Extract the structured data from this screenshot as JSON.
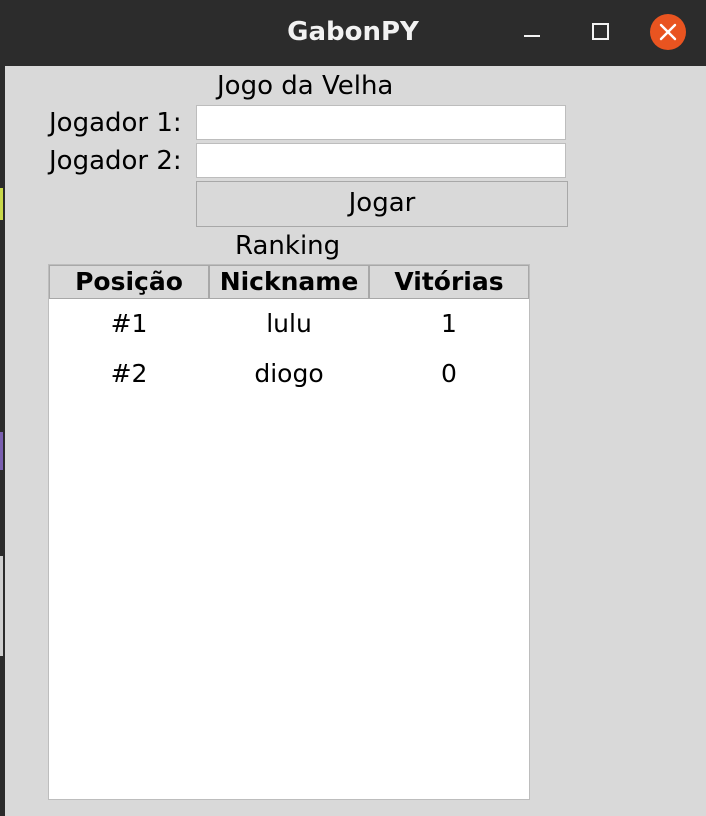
{
  "window": {
    "title": "GabonPY",
    "accent": "#e95420"
  },
  "game": {
    "title": "Jogo da Velha",
    "player1_label": "Jogador 1:",
    "player1_value": "",
    "player2_label": "Jogador 2:",
    "player2_value": "",
    "play_label": "Jogar"
  },
  "ranking": {
    "title": "Ranking",
    "columns": [
      "Posição",
      "Nickname",
      "Vitórias"
    ],
    "rows": [
      [
        "#1",
        "lulu",
        "1"
      ],
      [
        "#2",
        "diogo",
        "0"
      ]
    ]
  }
}
